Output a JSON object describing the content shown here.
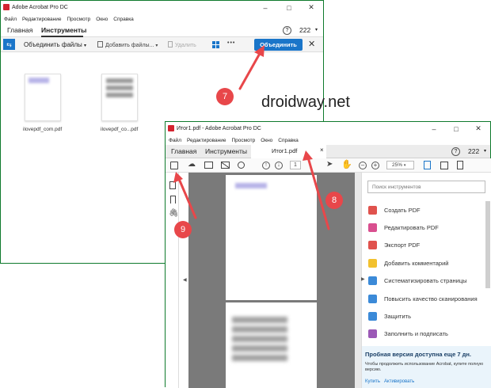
{
  "colors": {
    "accent": "#1a75c9",
    "frame": "#0e7a2c",
    "arrow": "#e8474a",
    "sidebar_dark": "#7a7a7a"
  },
  "back_window": {
    "title": "Adobe Acrobat Pro DC",
    "menu": [
      "Файл",
      "Редактирование",
      "Просмотр",
      "Окно",
      "Справка"
    ],
    "tabs": {
      "home": "Главная",
      "tools": "Инструменты"
    },
    "help_icon": "?",
    "count": "222",
    "toolbar": {
      "combine_files": "Объединить файлы",
      "add_files": "Добавить файлы...",
      "delete": "Удалить",
      "more": "•••",
      "combine_button": "Объединить"
    },
    "files": [
      {
        "name": "ilovepdf_com.pdf"
      },
      {
        "name": "ilovepdf_co...pdf"
      }
    ]
  },
  "watermark": "droidway.net",
  "front_window": {
    "title": "Итог1.pdf - Adobe Acrobat Pro DC",
    "menu": [
      "Файл",
      "Редактирование",
      "Просмотр",
      "Окно",
      "Справка"
    ],
    "tabs": {
      "home": "Главная",
      "tools": "Инструменты",
      "document": "Итог1.pdf",
      "close": "×"
    },
    "help_icon": "?",
    "count": "222",
    "toolbar": {
      "page": "1",
      "zoom": "25%"
    },
    "search_placeholder": "Поиск инструментов",
    "tools": [
      {
        "label": "Создать PDF",
        "icon": "create-pdf-icon",
        "color": "#e0524d"
      },
      {
        "label": "Редактировать PDF",
        "icon": "edit-pdf-icon",
        "color": "#d94f8f"
      },
      {
        "label": "Экспорт PDF",
        "icon": "export-pdf-icon",
        "color": "#e0524d"
      },
      {
        "label": "Добавить комментарий",
        "icon": "comment-icon",
        "color": "#f2c12e"
      },
      {
        "label": "Систематизировать страницы",
        "icon": "organize-pages-icon",
        "color": "#3b8ad8"
      },
      {
        "label": "Повысить качество сканирования",
        "icon": "enhance-scan-icon",
        "color": "#3b8ad8"
      },
      {
        "label": "Защитить",
        "icon": "protect-icon",
        "color": "#3b8ad8"
      },
      {
        "label": "Заполнить и подписать",
        "icon": "fill-sign-icon",
        "color": "#9b59b6"
      }
    ],
    "trial": {
      "title": "Пробная версия доступна еще 7 дн.",
      "body": "Чтобы продолжить использование Acrobat, купите полную версию.",
      "buy": "Купить",
      "activate": "Активировать"
    }
  },
  "annotations": [
    "7",
    "8",
    "9"
  ]
}
